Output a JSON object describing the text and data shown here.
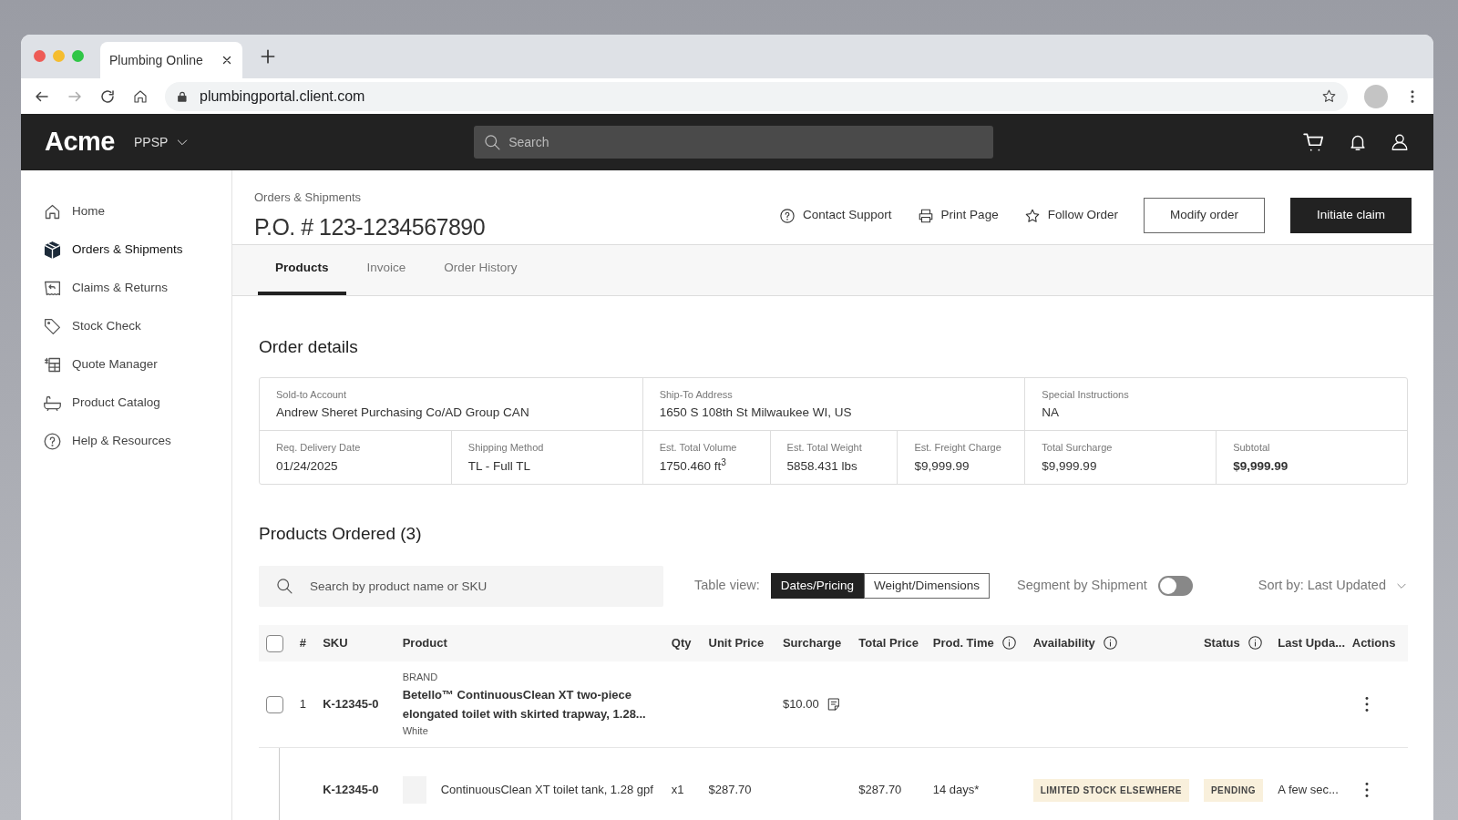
{
  "browser": {
    "tab_title": "Plumbing Online",
    "url": "plumbingportal.client.com"
  },
  "header": {
    "logo": "Acme",
    "org": "PPSP",
    "search_placeholder": "Search"
  },
  "sidebar": {
    "items": [
      {
        "label": "Home",
        "selected": false
      },
      {
        "label": "Orders & Shipments",
        "selected": true
      },
      {
        "label": "Claims & Returns",
        "selected": false
      },
      {
        "label": "Stock Check",
        "selected": false
      },
      {
        "label": "Quote Manager",
        "selected": false
      },
      {
        "label": "Product Catalog",
        "selected": false
      },
      {
        "label": "Help & Resources",
        "selected": false
      }
    ]
  },
  "page": {
    "breadcrumb": "Orders & Shipments",
    "title": "P.O. # 123-1234567890",
    "actions": [
      {
        "label": "Contact Support"
      },
      {
        "label": "Print Page"
      },
      {
        "label": "Follow Order"
      }
    ],
    "buttons": [
      {
        "label": "Modify order",
        "kind": "outline"
      },
      {
        "label": "Initiate claim",
        "kind": "primary"
      }
    ]
  },
  "tabs": [
    {
      "label": "Products",
      "selected": true
    },
    {
      "label": "Invoice",
      "selected": false
    },
    {
      "label": "Order History",
      "selected": false
    }
  ],
  "order_details": {
    "title": "Order details",
    "account": [
      {
        "label": "Sold-to Account",
        "value": "Andrew Sheret Purchasing Co/AD Group CAN",
        "bold": false
      },
      {
        "label": "Ship-To Address",
        "value": "1650 S 108th St Milwaukee WI, US",
        "bold": false
      },
      {
        "label": "Special Instructions",
        "value": "NA",
        "bold": false
      }
    ],
    "summary": [
      {
        "label": "Req. Delivery Date",
        "value": "01/24/2025",
        "bold": false
      },
      {
        "label": "Shipping Method",
        "value": "TL - Full TL",
        "bold": false
      },
      {
        "label": "Est. Total Volume",
        "value": "1750.460 ft$^{3}$",
        "bold": false
      },
      {
        "label": "Est. Total Weight",
        "value": "5858.431 lbs",
        "bold": false
      },
      {
        "label": "Est. Freight Charge",
        "value": "$9,999.99",
        "bold": false
      },
      {
        "label": "Total Surcharge",
        "value": "$9,999.99",
        "bold": false
      },
      {
        "label": "Subtotal",
        "value": "$9,999.99",
        "bold": true
      }
    ]
  },
  "products": {
    "title": "Products Ordered (3)",
    "search_placeholder": "Search by product name or SKU",
    "table_view_label": "Table view:",
    "views": [
      {
        "label": "Dates/Pricing",
        "selected": true
      },
      {
        "label": "Weight/Dimensions",
        "selected": false
      }
    ],
    "segment": {
      "label": "Segment by Shipment",
      "on": false
    },
    "sort": "Sort by: Last Updated",
    "table": {
      "select_all_checked": false,
      "columns": [
        "#",
        "SKU",
        "Product",
        "Qty",
        "Unit Price",
        "Surcharge",
        "Total Price",
        "Prod. Time",
        "Availability",
        "Status",
        "Last Upda...",
        "Actions"
      ],
      "rows": [
        {
          "kind": "parent",
          "checked": false,
          "number": "1",
          "sku": "K-12345-0",
          "brand": "BRAND",
          "product": "Betello™ ContinuousClean XT two-piece elongated toilet with skirted trapway, 1.28...",
          "variant": "White",
          "surcharge": "$10.00"
        },
        {
          "kind": "child",
          "sku": "K-12345-0",
          "product": "ContinuousClean XT toilet tank, 1.28 gpf",
          "qty": "x1",
          "unit_price": "$287.70",
          "total_price": "$287.70",
          "prod_time": "14 days*",
          "availability": "LIMITED STOCK ELSEWHERE",
          "status": "PENDING",
          "last_updated": "A few sec..."
        }
      ]
    }
  }
}
